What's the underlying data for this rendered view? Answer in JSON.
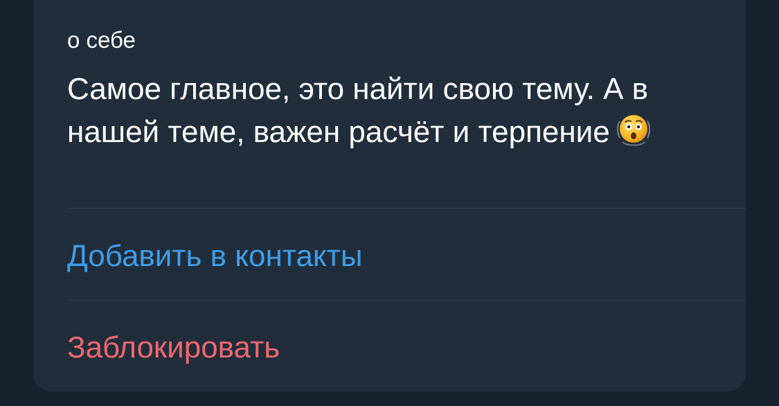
{
  "profile": {
    "about_label": "о себе",
    "about_text": "Самое главное, это найти свою тему. А в нашей теме, важен расчёт и терпение",
    "about_emoji_icon": "astonished-face-icon"
  },
  "actions": {
    "add_contact": "Добавить в контакты",
    "block": "Заблокировать"
  },
  "colors": {
    "background": "#18222d",
    "card": "#212d3b",
    "text": "#ffffff",
    "link_blue": "#3e9ee8",
    "destructive_red": "#ee686e",
    "divider": "#2f3d4c"
  }
}
